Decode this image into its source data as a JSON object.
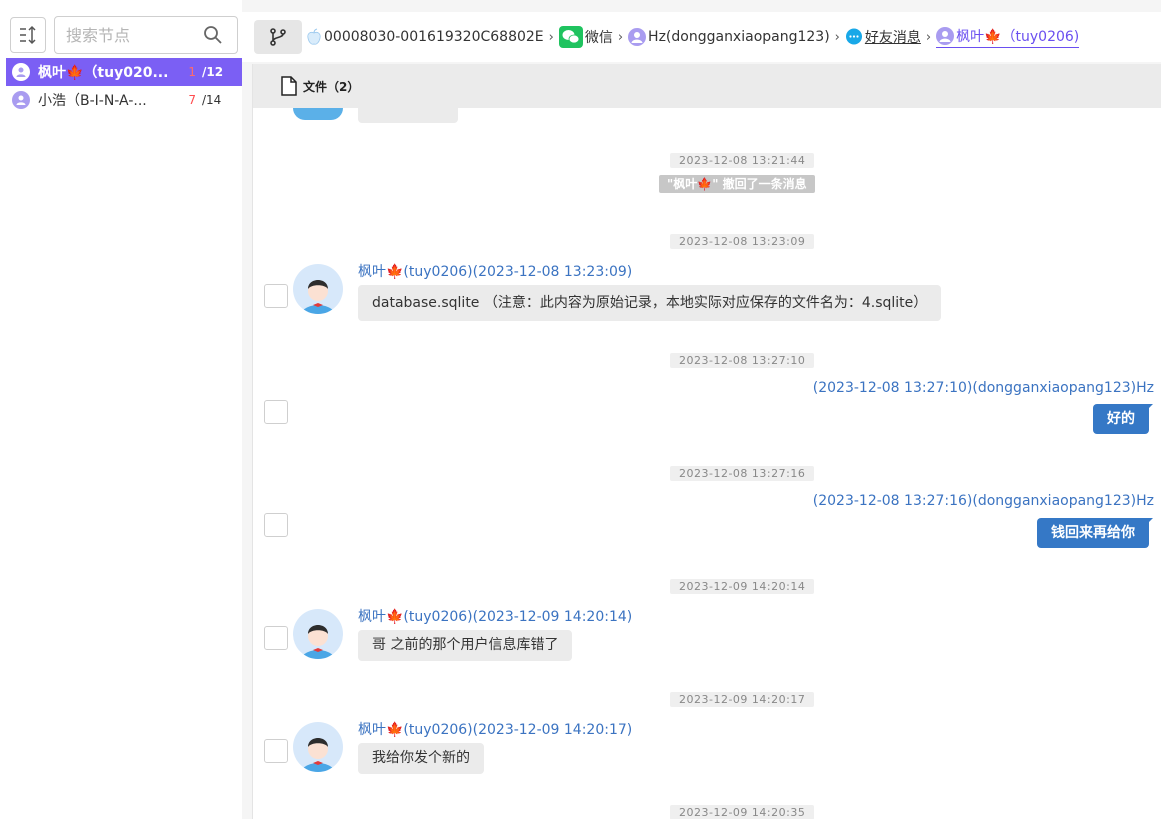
{
  "sidebar": {
    "search_placeholder": "搜索节点",
    "contacts": [
      {
        "name": "枫叶🍁（tuy020...",
        "unread": "1",
        "total": "/12"
      },
      {
        "name": "小浩（B-I-N-A-...",
        "unread": "7",
        "total": "/14"
      }
    ]
  },
  "breadcrumbs": [
    {
      "label": "00008030-001619320C68802E",
      "icon": "apple-icon"
    },
    {
      "label": "微信",
      "icon": "wechat-icon"
    },
    {
      "label": "Hz(dongganxiaopang123)",
      "icon": "user-icon"
    },
    {
      "label": "好友消息",
      "icon": "chat-bubble-icon"
    },
    {
      "label": "枫叶🍁（tuy0206)",
      "icon": "user-icon"
    }
  ],
  "files_bar": {
    "label": "文件（2）"
  },
  "messages": {
    "m1": {
      "time": "2023-12-08 13:21:44",
      "system": "\"枫叶🍁\" 撤回了一条消息"
    },
    "m2": {
      "time": "2023-12-08 13:23:09",
      "sender": "枫叶🍁(tuy0206)(2023-12-08 13:23:09)",
      "text": "database.sqlite （注意：此内容为原始记录，本地实际对应保存的文件名为：4.sqlite）"
    },
    "m3": {
      "time": "2023-12-08 13:27:10",
      "sender": "(2023-12-08 13:27:10)(dongganxiaopang123)Hz",
      "text": "好的"
    },
    "m4": {
      "time": "2023-12-08 13:27:16",
      "sender": "(2023-12-08 13:27:16)(dongganxiaopang123)Hz",
      "text": "钱回来再给你"
    },
    "m5": {
      "time": "2023-12-09 14:20:14",
      "sender": "枫叶🍁(tuy0206)(2023-12-09 14:20:14)",
      "text": "哥 之前的那个用户信息库错了"
    },
    "m6": {
      "time": "2023-12-09 14:20:17",
      "sender": "枫叶🍁(tuy0206)(2023-12-09 14:20:17)",
      "text": "我给你发个新的"
    },
    "m7": {
      "time": "2023-12-09 14:20:35"
    }
  },
  "colors": {
    "accent": "#7b5ff4",
    "outgoing_bubble": "#3578c6",
    "sender_text": "#3b73c1",
    "unread": "#ff4d4f"
  }
}
